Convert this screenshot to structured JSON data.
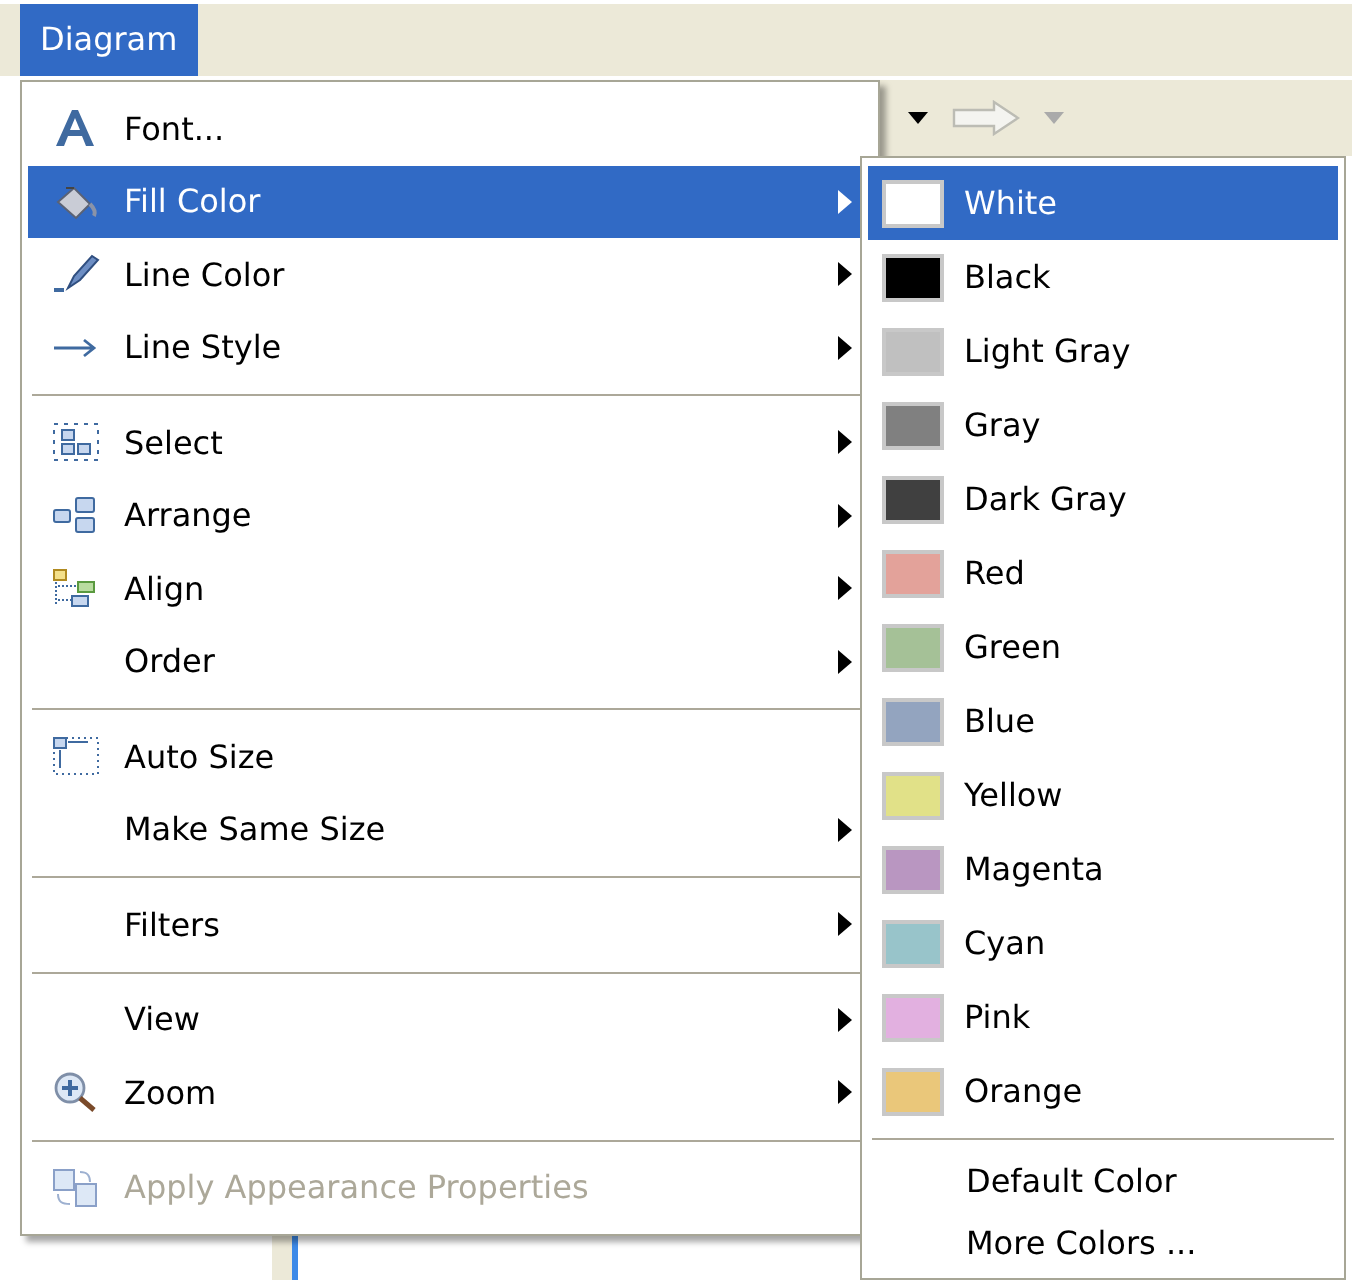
{
  "menubar": [
    {
      "label": "Diagram",
      "selected": true
    }
  ],
  "menu": {
    "items": [
      {
        "kind": "item",
        "label": "Font...",
        "icon": true,
        "submenu": false,
        "selected": false,
        "disabled": false
      },
      {
        "kind": "item",
        "label": "Fill Color",
        "icon": true,
        "submenu": true,
        "selected": true,
        "disabled": false
      },
      {
        "kind": "item",
        "label": "Line Color",
        "icon": true,
        "submenu": true,
        "selected": false,
        "disabled": false
      },
      {
        "kind": "item",
        "label": "Line Style",
        "icon": true,
        "submenu": true,
        "selected": false,
        "disabled": false
      },
      {
        "kind": "separator"
      },
      {
        "kind": "item",
        "label": "Select",
        "icon": true,
        "submenu": true,
        "selected": false,
        "disabled": false
      },
      {
        "kind": "item",
        "label": "Arrange",
        "icon": true,
        "submenu": true,
        "selected": false,
        "disabled": false
      },
      {
        "kind": "item",
        "label": "Align",
        "icon": true,
        "submenu": true,
        "selected": false,
        "disabled": false
      },
      {
        "kind": "item",
        "label": "Order",
        "icon": false,
        "submenu": true,
        "selected": false,
        "disabled": false
      },
      {
        "kind": "separator"
      },
      {
        "kind": "item",
        "label": "Auto Size",
        "icon": true,
        "submenu": false,
        "selected": false,
        "disabled": false
      },
      {
        "kind": "item",
        "label": "Make Same Size",
        "icon": false,
        "submenu": true,
        "selected": false,
        "disabled": false
      },
      {
        "kind": "separator"
      },
      {
        "kind": "item",
        "label": "Filters",
        "icon": false,
        "submenu": true,
        "selected": false,
        "disabled": false
      },
      {
        "kind": "separator"
      },
      {
        "kind": "item",
        "label": "View",
        "icon": false,
        "submenu": true,
        "selected": false,
        "disabled": false
      },
      {
        "kind": "item",
        "label": "Zoom",
        "icon": true,
        "submenu": true,
        "selected": false,
        "disabled": false
      },
      {
        "kind": "separator"
      },
      {
        "kind": "item",
        "label": "Apply Appearance Properties",
        "icon": true,
        "submenu": false,
        "selected": false,
        "disabled": true
      }
    ]
  },
  "submenu": {
    "items": [
      {
        "kind": "color",
        "label": "White",
        "color": "#ffffff",
        "selected": true
      },
      {
        "kind": "color",
        "label": "Black",
        "color": "#000000",
        "selected": false
      },
      {
        "kind": "color",
        "label": "Light Gray",
        "color": "#c0c0c0",
        "selected": false
      },
      {
        "kind": "color",
        "label": "Gray",
        "color": "#808080",
        "selected": false
      },
      {
        "kind": "color",
        "label": "Dark Gray",
        "color": "#404040",
        "selected": false
      },
      {
        "kind": "color",
        "label": "Red",
        "color": "#e3a29a",
        "selected": false
      },
      {
        "kind": "color",
        "label": "Green",
        "color": "#a5c197",
        "selected": false
      },
      {
        "kind": "color",
        "label": "Blue",
        "color": "#93a4bf",
        "selected": false
      },
      {
        "kind": "color",
        "label": "Yellow",
        "color": "#e1e188",
        "selected": false
      },
      {
        "kind": "color",
        "label": "Magenta",
        "color": "#b996c1",
        "selected": false
      },
      {
        "kind": "color",
        "label": "Cyan",
        "color": "#98c4ca",
        "selected": false
      },
      {
        "kind": "color",
        "label": "Pink",
        "color": "#e2b0e0",
        "selected": false
      },
      {
        "kind": "color",
        "label": "Orange",
        "color": "#eac77a",
        "selected": false
      },
      {
        "kind": "separator"
      },
      {
        "kind": "action",
        "label": "Default Color",
        "selected": false
      },
      {
        "kind": "action",
        "label": "More Colors ...",
        "selected": false
      }
    ]
  }
}
